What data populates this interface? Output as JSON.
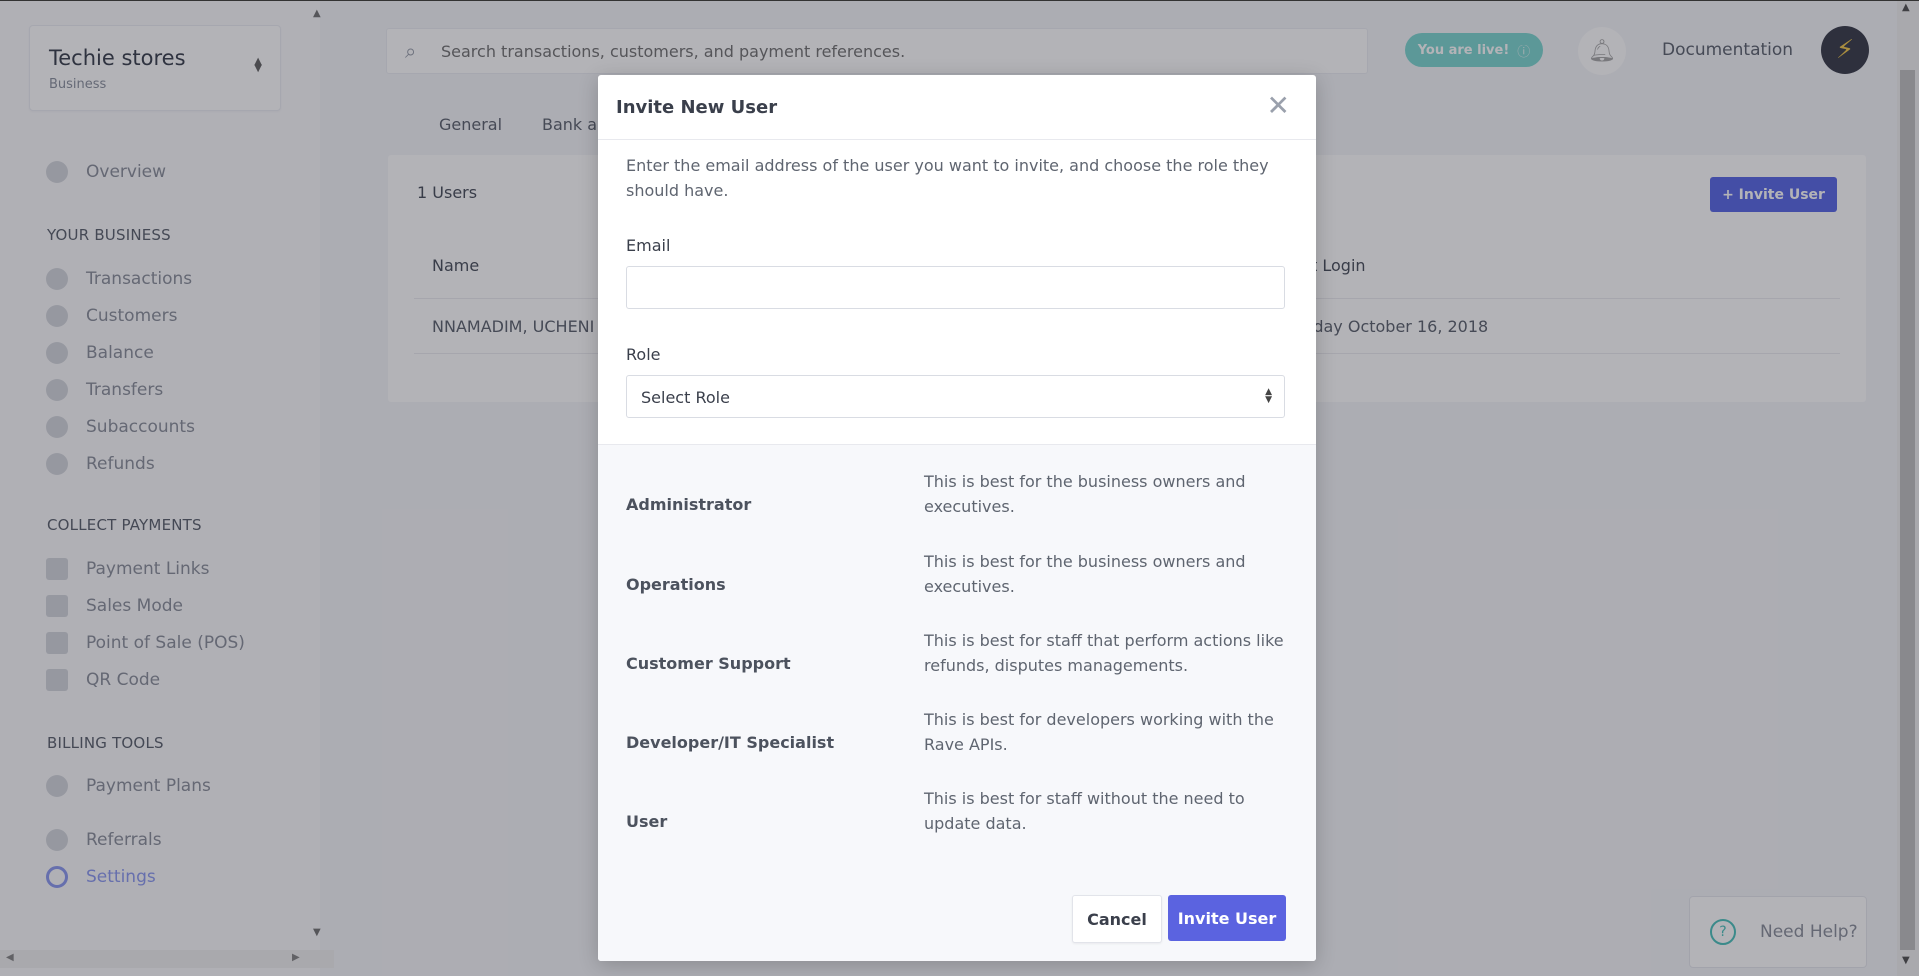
{
  "business": {
    "name": "Techie stores",
    "type": "Business"
  },
  "sidebar": {
    "overview": "Overview",
    "sections": {
      "your_business": "YOUR BUSINESS",
      "collect_payments": "COLLECT PAYMENTS",
      "billing_tools": "BILLING TOOLS"
    },
    "items": {
      "transactions": "Transactions",
      "customers": "Customers",
      "balance": "Balance",
      "transfers": "Transfers",
      "subaccounts": "Subaccounts",
      "refunds": "Refunds",
      "payment_links": "Payment Links",
      "sales_mode": "Sales Mode",
      "pos": "Point of Sale (POS)",
      "qr_code": "QR Code",
      "payment_plans": "Payment Plans",
      "referrals": "Referrals",
      "settings": "Settings"
    }
  },
  "header": {
    "search_placeholder": "Search transactions, customers, and payment references.",
    "live_badge": "You are live!",
    "documentation": "Documentation"
  },
  "tabs": {
    "general": "General",
    "bank": "Bank ac"
  },
  "users": {
    "count_label": "1 Users",
    "invite_button": "+ Invite User",
    "columns": {
      "name": "Name",
      "last_login": "t Login"
    },
    "row": {
      "name": "NNAMADIM, UCHENI",
      "last_login": "sday October 16, 2018"
    }
  },
  "help": {
    "label": "Need Help?"
  },
  "modal": {
    "title": "Invite New User",
    "intro": "Enter the email address of the user you want to invite, and choose the role they should have.",
    "email_label": "Email",
    "email_value": "",
    "role_label": "Role",
    "role_selected": "Select Role",
    "roles": [
      {
        "name": "Administrator",
        "desc": "This is best for the business owners and executives."
      },
      {
        "name": "Operations",
        "desc": "This is best for the business owners and executives."
      },
      {
        "name": "Customer Support",
        "desc": "This is best for staff that perform actions like refunds, disputes managements."
      },
      {
        "name": "Developer/IT Specialist",
        "desc": "This is best for developers working with the Rave APIs."
      },
      {
        "name": "User",
        "desc": "This is best for staff without the need to update data."
      }
    ],
    "cancel": "Cancel",
    "invite": "Invite User"
  }
}
